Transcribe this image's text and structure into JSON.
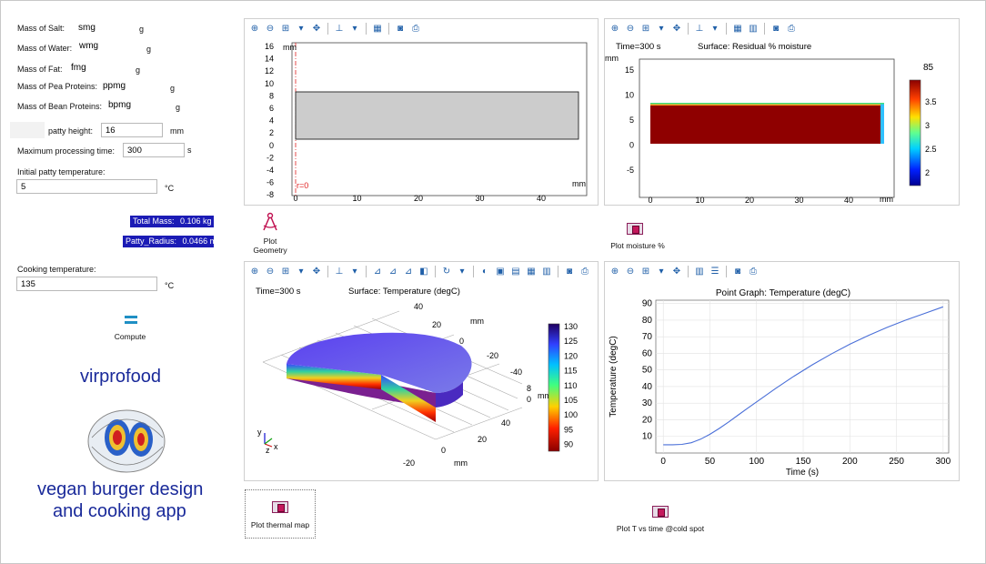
{
  "inputs": [
    {
      "label": "Mass of Salt:",
      "value": "smg",
      "unit": "g"
    },
    {
      "label": "Mass of Water:",
      "value": "wmg",
      "unit": "g"
    },
    {
      "label": "Mass of Fat:",
      "value": "fmg",
      "unit": "g"
    },
    {
      "label": "Mass of Pea Proteins:",
      "value": "ppmg",
      "unit": "g"
    },
    {
      "label": "Mass of Bean Proteins:",
      "value": "bpmg",
      "unit": "g"
    }
  ],
  "patty_height": {
    "label": "patty height:",
    "value": "16",
    "unit": "mm"
  },
  "max_time": {
    "label": "Maximum processing time:",
    "value": "300",
    "unit": "s"
  },
  "initial_temp": {
    "label": "Initial patty temperature:",
    "value": "5",
    "unit": "°C"
  },
  "outputs": {
    "total_mass_label": "Total Mass:",
    "total_mass_value": "0.106 kg",
    "radius_label": "Patty_Radius:",
    "radius_value": "0.0466 m"
  },
  "cooking_temp": {
    "label": "Cooking temperature:",
    "value": "135",
    "unit": "°C"
  },
  "compute_label": "Compute",
  "brand": {
    "name": "virprofood",
    "tagline_1": "vegan burger design",
    "tagline_2": "and cooking app"
  },
  "buttons": {
    "plot_geometry_1": "Plot",
    "plot_geometry_2": "Geometry",
    "plot_moisture": "Plot moisture %",
    "plot_thermal": "Plot thermal map",
    "plot_t_vs_time": "Plot T vs time @cold spot"
  },
  "geometry_plot": {
    "y_ticks": [
      "16",
      "14",
      "12",
      "10",
      "8",
      "6",
      "4",
      "2",
      "0",
      "-2",
      "-4",
      "-6",
      "-8"
    ],
    "x_ticks": [
      "0",
      "10",
      "20",
      "30",
      "40"
    ],
    "unit": "mm",
    "axis_label": "r=0"
  },
  "moisture_plot": {
    "time": "Time=300 s",
    "title": "Surface: Residual % moisture",
    "y_ticks": [
      "15",
      "10",
      "5",
      "0",
      "-5"
    ],
    "x_ticks": [
      "0",
      "10",
      "20",
      "30",
      "40"
    ],
    "unit": "mm",
    "cb_max": "85",
    "cb_ticks": [
      "3.5",
      "3",
      "2.5",
      "2"
    ]
  },
  "thermal_plot": {
    "time": "Time=300 s",
    "title": "Surface: Temperature (degC)",
    "cb_ticks": [
      "130",
      "125",
      "120",
      "115",
      "110",
      "105",
      "100",
      "95",
      "90"
    ],
    "ax_y_ticks": [
      "40",
      "20",
      "0",
      "-20",
      "-40"
    ],
    "ax_x_ticks": [
      "40",
      "20",
      "0",
      "-20"
    ],
    "ax_z_ticks": [
      "8",
      "0"
    ],
    "unit": "mm",
    "axis_y": "y",
    "axis_z": "z",
    "axis_x": "x"
  },
  "chart_data": {
    "type": "line",
    "title": "Point Graph: Temperature (degC)",
    "xlabel": "Time (s)",
    "ylabel": "Temperature (degC)",
    "xlim": [
      -8,
      306
    ],
    "ylim": [
      0,
      92
    ],
    "x_ticks": [
      0,
      50,
      100,
      150,
      200,
      250,
      300
    ],
    "y_ticks": [
      10,
      20,
      30,
      40,
      50,
      60,
      70,
      80,
      90
    ],
    "grid": true,
    "series": [
      {
        "x": [
          0,
          10,
          20,
          30,
          40,
          50,
          60,
          70,
          80,
          90,
          100,
          120,
          140,
          160,
          180,
          200,
          220,
          240,
          260,
          280,
          300
        ],
        "y": [
          5,
          5,
          5.2,
          6.2,
          8.3,
          11.3,
          14.8,
          18.7,
          22.7,
          26.8,
          30.8,
          38.7,
          46.2,
          53.2,
          59.6,
          65.5,
          70.8,
          75.6,
          80.0,
          84.0,
          88.0
        ]
      }
    ],
    "color": "#4a6fd8"
  }
}
